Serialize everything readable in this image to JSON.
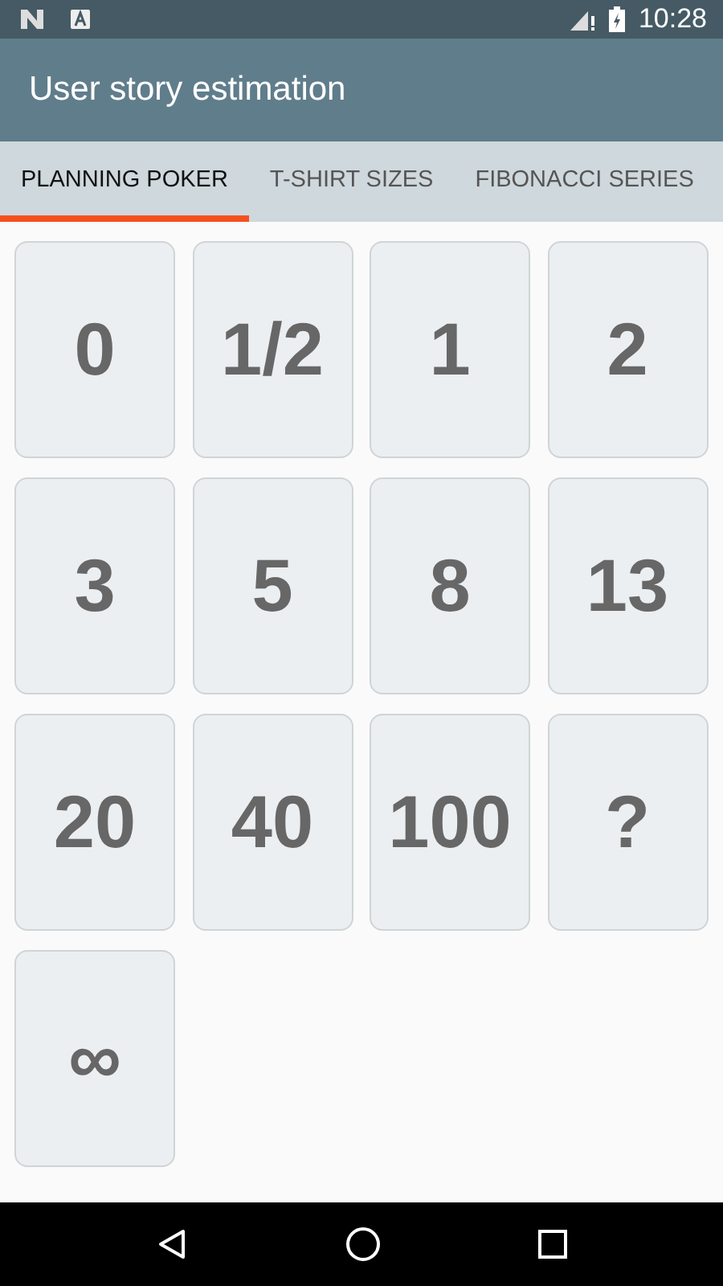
{
  "status_bar": {
    "time": "10:28"
  },
  "app_bar": {
    "title": "User story estimation"
  },
  "tabs": [
    {
      "label": "PLANNING POKER",
      "selected": true
    },
    {
      "label": "T-SHIRT SIZES",
      "selected": false
    },
    {
      "label": "FIBONACCI SERIES",
      "selected": false
    }
  ],
  "cards": [
    "0",
    "1/2",
    "1",
    "2",
    "3",
    "5",
    "8",
    "13",
    "20",
    "40",
    "100",
    "?",
    "∞"
  ]
}
